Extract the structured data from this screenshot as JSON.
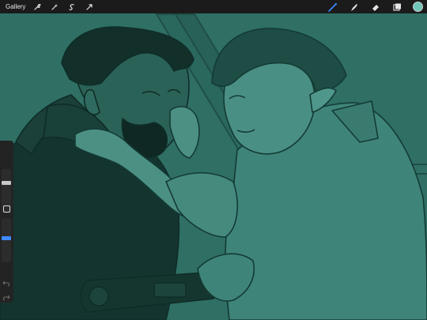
{
  "toolbar": {
    "gallery_label": "Gallery",
    "left_tools": [
      "wrench-icon",
      "magic-wand-icon",
      "selection-icon",
      "transform-arrow-icon"
    ],
    "right_tools": [
      "brush-icon",
      "smudge-icon",
      "eraser-icon",
      "layers-icon"
    ],
    "active_tool": "brush-icon",
    "active_color": "#6fc6b9"
  },
  "sidebar": {
    "brush_size": 0.3,
    "brush_opacity": 0.45
  },
  "colors": {
    "canvas_background": "#2f6f64",
    "toolbar_background": "#1b1b1b",
    "accent": "#3d8bff"
  }
}
